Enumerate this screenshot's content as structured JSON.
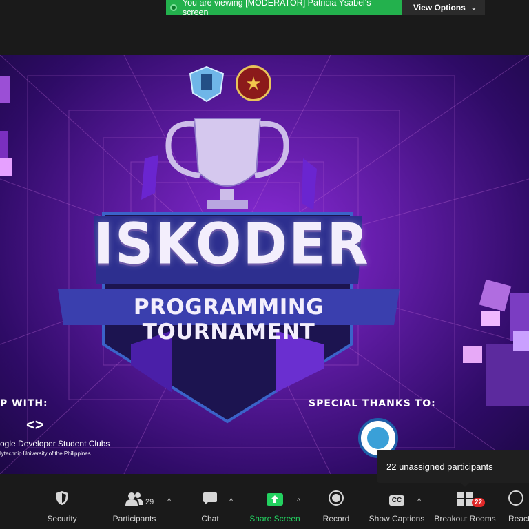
{
  "banner": {
    "viewing_text": "You are viewing [MODERATOR] Patricia Ysabel's screen",
    "view_options_label": "View Options",
    "accent_color": "#23b14d"
  },
  "shared_screen": {
    "title_main": "ISKODER",
    "title_sub": "PROGRAMMING TOURNAMENT",
    "partner_heading": "P WITH:",
    "partner_icon": "<>",
    "partner_name": "ogle Developer Student Clubs",
    "partner_school": "lytechnic University of the Philippines",
    "thanks_heading": "SPECIAL THANKS TO:"
  },
  "tooltip": {
    "text": "22 unassigned participants"
  },
  "toolbar": {
    "security": "Security",
    "participants": "Participants",
    "participants_count": "29",
    "chat": "Chat",
    "share_screen": "Share Screen",
    "record": "Record",
    "show_captions": "Show Captions",
    "captions_icon": "CC",
    "breakout_rooms": "Breakout Rooms",
    "breakout_badge": "22",
    "reactions": "Reacti"
  },
  "colors": {
    "share_green": "#23d160",
    "badge_red": "#e02828"
  }
}
